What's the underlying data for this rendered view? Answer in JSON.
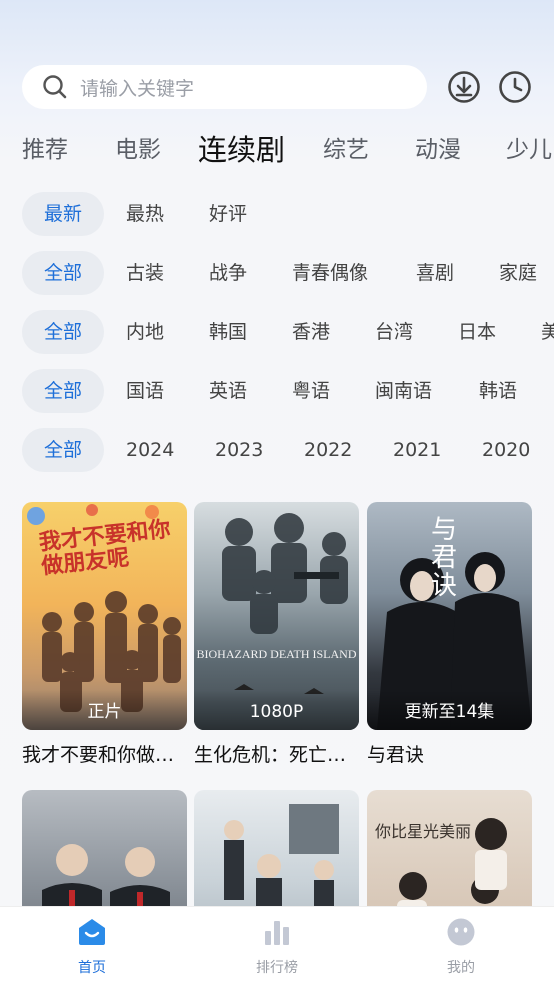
{
  "search": {
    "placeholder": "请输入关键字"
  },
  "header_icons": [
    "download-icon",
    "history-icon"
  ],
  "tabs": [
    {
      "label": "推荐",
      "active": false
    },
    {
      "label": "电影",
      "active": false
    },
    {
      "label": "连续剧",
      "active": true
    },
    {
      "label": "综艺",
      "active": false
    },
    {
      "label": "动漫",
      "active": false
    },
    {
      "label": "少儿",
      "active": false
    }
  ],
  "filters": {
    "sort": [
      "最新",
      "最热",
      "好评"
    ],
    "genre": [
      "全部",
      "古装",
      "战争",
      "青春偶像",
      "喜剧",
      "家庭"
    ],
    "region": [
      "全部",
      "内地",
      "韩国",
      "香港",
      "台湾",
      "日本",
      "美"
    ],
    "language": [
      "全部",
      "国语",
      "英语",
      "粤语",
      "闽南语",
      "韩语"
    ],
    "year": [
      "全部",
      "2024",
      "2023",
      "2022",
      "2021",
      "2020"
    ]
  },
  "cards": [
    {
      "title": "我才不要和你做…",
      "badge": "正片",
      "poster_text": "我才不要和你做朋友呢"
    },
    {
      "title": "生化危机：死亡…",
      "badge": "1080P",
      "poster_text": "BIOHAZARD DEATH ISLAND"
    },
    {
      "title": "与君诀",
      "badge": "更新至14集",
      "poster_text": "与君诀"
    },
    {
      "title": "",
      "badge": "",
      "poster_text": ""
    },
    {
      "title": "",
      "badge": "",
      "poster_text": ""
    },
    {
      "title": "",
      "badge": "",
      "poster_text": "你比星光美丽"
    }
  ],
  "bottom_nav": [
    {
      "label": "首页",
      "icon": "home-icon",
      "active": true
    },
    {
      "label": "排行榜",
      "icon": "ranking-icon",
      "active": false
    },
    {
      "label": "我的",
      "icon": "profile-icon",
      "active": false
    }
  ],
  "colors": {
    "accent": "#1e6fd9"
  }
}
